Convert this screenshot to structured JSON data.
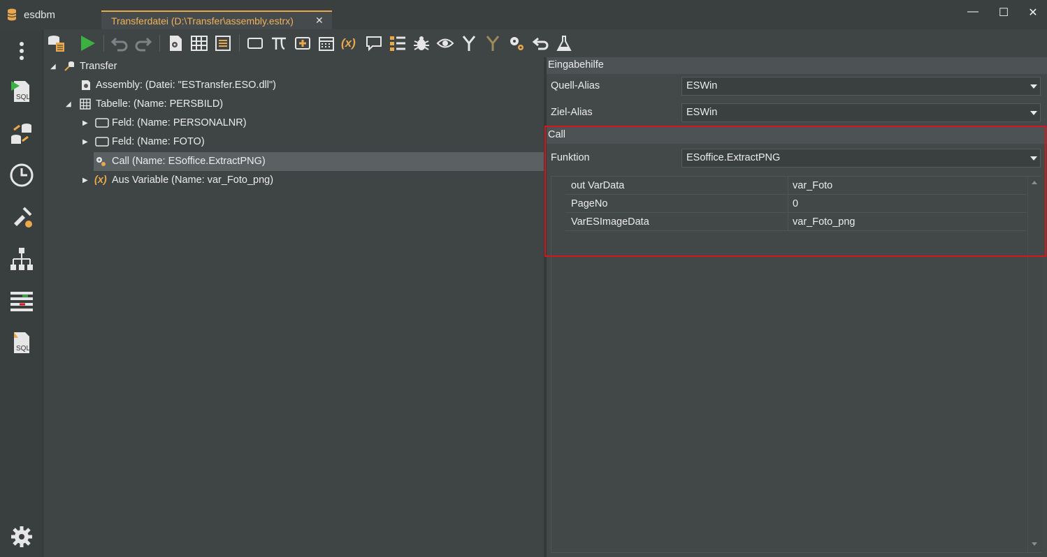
{
  "app": {
    "title": "esdbm"
  },
  "tab": {
    "label": "Transferdatei (D:\\Transfer\\assembly.estrx)",
    "close": "✕"
  },
  "window": {
    "minimize": "—",
    "maximize": "☐",
    "close": "✕"
  },
  "tree": {
    "root": "Transfer",
    "assembly": "Assembly: (Datei: \"ESTransfer.ESO.dll\")",
    "table": "Tabelle: (Name: PERSBILD)",
    "field1": "Feld: (Name: PERSONALNR)",
    "field2": "Feld: (Name: FOTO)",
    "call": "Call (Name: ESoffice.ExtractPNG)",
    "variable": "Aus Variable (Name: var_Foto_png)",
    "variable_icon_text": "(x)"
  },
  "props": {
    "section_main": "Eingabehilfe",
    "source_alias_label": "Quell-Alias",
    "source_alias_value": "ESWin",
    "target_alias_label": "Ziel-Alias",
    "target_alias_value": "ESWin",
    "section_call": "Call",
    "function_label": "Funktion",
    "function_value": "ESoffice.ExtractPNG",
    "params": [
      {
        "name": "out VarData",
        "value": "var_Foto"
      },
      {
        "name": "PageNo",
        "value": "0"
      },
      {
        "name": "VarESImageData",
        "value": "var_Foto_png"
      }
    ]
  },
  "toolbar": {
    "variable_icon_text": "(x)"
  },
  "colors": {
    "accent": "#f0b25a",
    "highlight": "#d4171c",
    "play": "#3cb043"
  }
}
